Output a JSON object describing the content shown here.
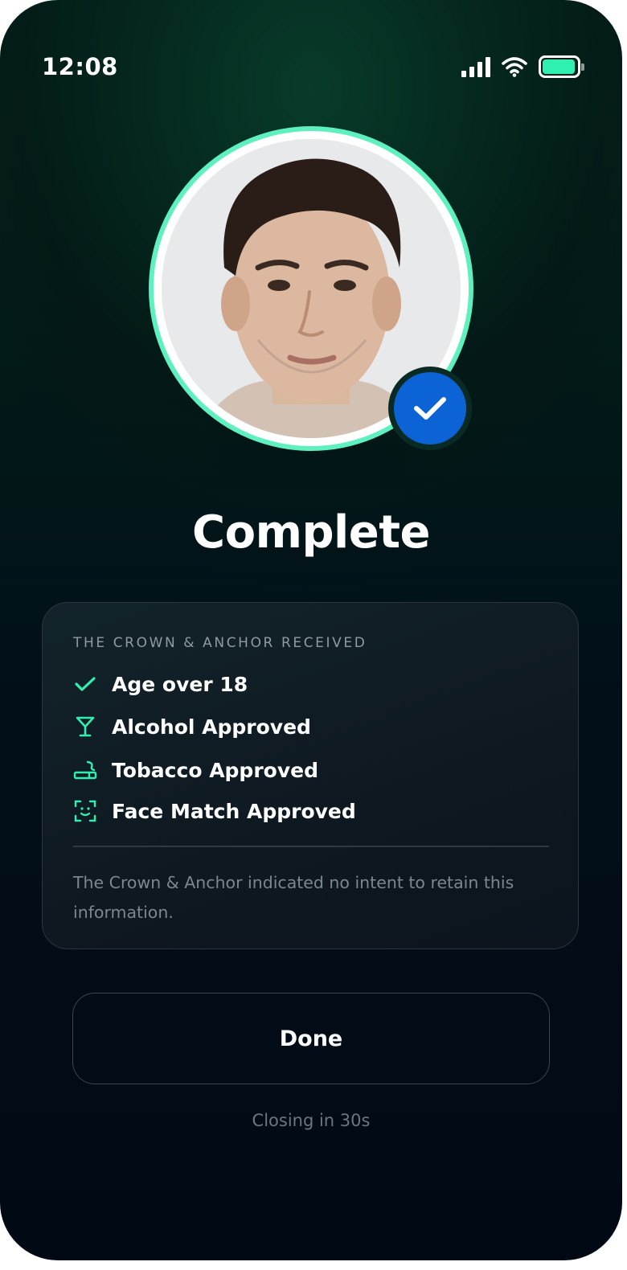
{
  "status_bar": {
    "time": "12:08",
    "icons": [
      "cellular-signal-icon",
      "wifi-icon",
      "battery-icon"
    ],
    "battery_level": 0.95
  },
  "profile": {
    "avatar": "user-face-photo",
    "verified_icon": "checkmark-icon"
  },
  "title": "Complete",
  "card": {
    "header": "THE CROWN & ANCHOR RECEIVED",
    "items": [
      {
        "icon": "checkmark-icon",
        "label": "Age over 18"
      },
      {
        "icon": "cocktail-glass-icon",
        "label": "Alcohol Approved"
      },
      {
        "icon": "cigarette-icon",
        "label": "Tobacco Approved"
      },
      {
        "icon": "face-scan-icon",
        "label": "Face Match Approved"
      }
    ],
    "note": "The Crown & Anchor indicated no intent to retain this information."
  },
  "actions": {
    "done_label": "Done",
    "closing_text": "Closing in 30s"
  },
  "colors": {
    "accent": "#2FF0B0",
    "badge": "#0B63D6",
    "background": "#010A14"
  }
}
